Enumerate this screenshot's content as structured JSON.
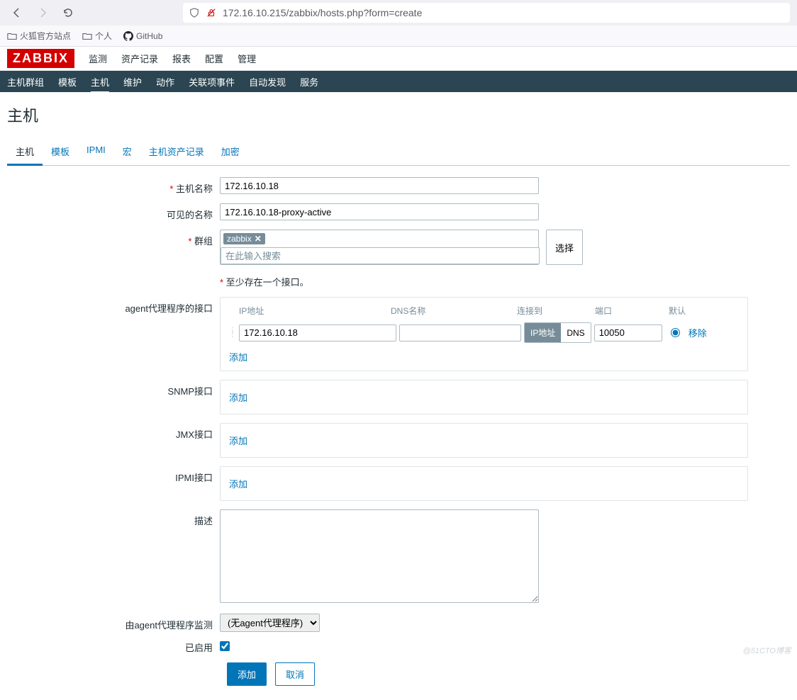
{
  "browser": {
    "url": "172.16.10.215/zabbix/hosts.php?form=create",
    "bookmarks": [
      {
        "label": "火狐官方站点"
      },
      {
        "label": "个人"
      },
      {
        "label": "GitHub"
      }
    ]
  },
  "logo_text": "ZABBIX",
  "main_nav": {
    "items": [
      "监测",
      "资产记录",
      "报表",
      "配置",
      "管理"
    ],
    "active_index": 3
  },
  "sub_nav": {
    "items": [
      "主机群组",
      "模板",
      "主机",
      "维护",
      "动作",
      "关联项事件",
      "自动发现",
      "服务"
    ],
    "active_index": 2
  },
  "page_title": "主机",
  "tabs": {
    "items": [
      "主机",
      "模板",
      "IPMI",
      "宏",
      "主机资产记录",
      "加密"
    ],
    "active_index": 0
  },
  "form": {
    "host_name_label": "主机名称",
    "host_name_value": "172.16.10.18",
    "visible_name_label": "可见的名称",
    "visible_name_value": "172.16.10.18-proxy-active",
    "groups_label": "群组",
    "group_tag": "zabbix",
    "groups_placeholder": "在此输入搜索",
    "select_btn": "选择",
    "iface_warn": "至少存在一个接口。",
    "agent_iface_label": "agent代理程序的接口",
    "headers": {
      "ip": "IP地址",
      "dns": "DNS名称",
      "connect": "连接到",
      "port": "端口",
      "default": "默认"
    },
    "iface_ip_value": "172.16.10.18",
    "iface_dns_value": "",
    "connect_ip": "IP地址",
    "connect_dns": "DNS",
    "iface_port_value": "10050",
    "remove_link": "移除",
    "add_link": "添加",
    "snmp_label": "SNMP接口",
    "jmx_label": "JMX接口",
    "ipmi_label": "IPMI接口",
    "description_label": "描述",
    "description_value": "",
    "proxy_label": "由agent代理程序监测",
    "proxy_value": "(无agent代理程序)",
    "enabled_label": "已启用",
    "submit_add": "添加",
    "submit_cancel": "取消"
  },
  "watermark": "@51CTO博客"
}
